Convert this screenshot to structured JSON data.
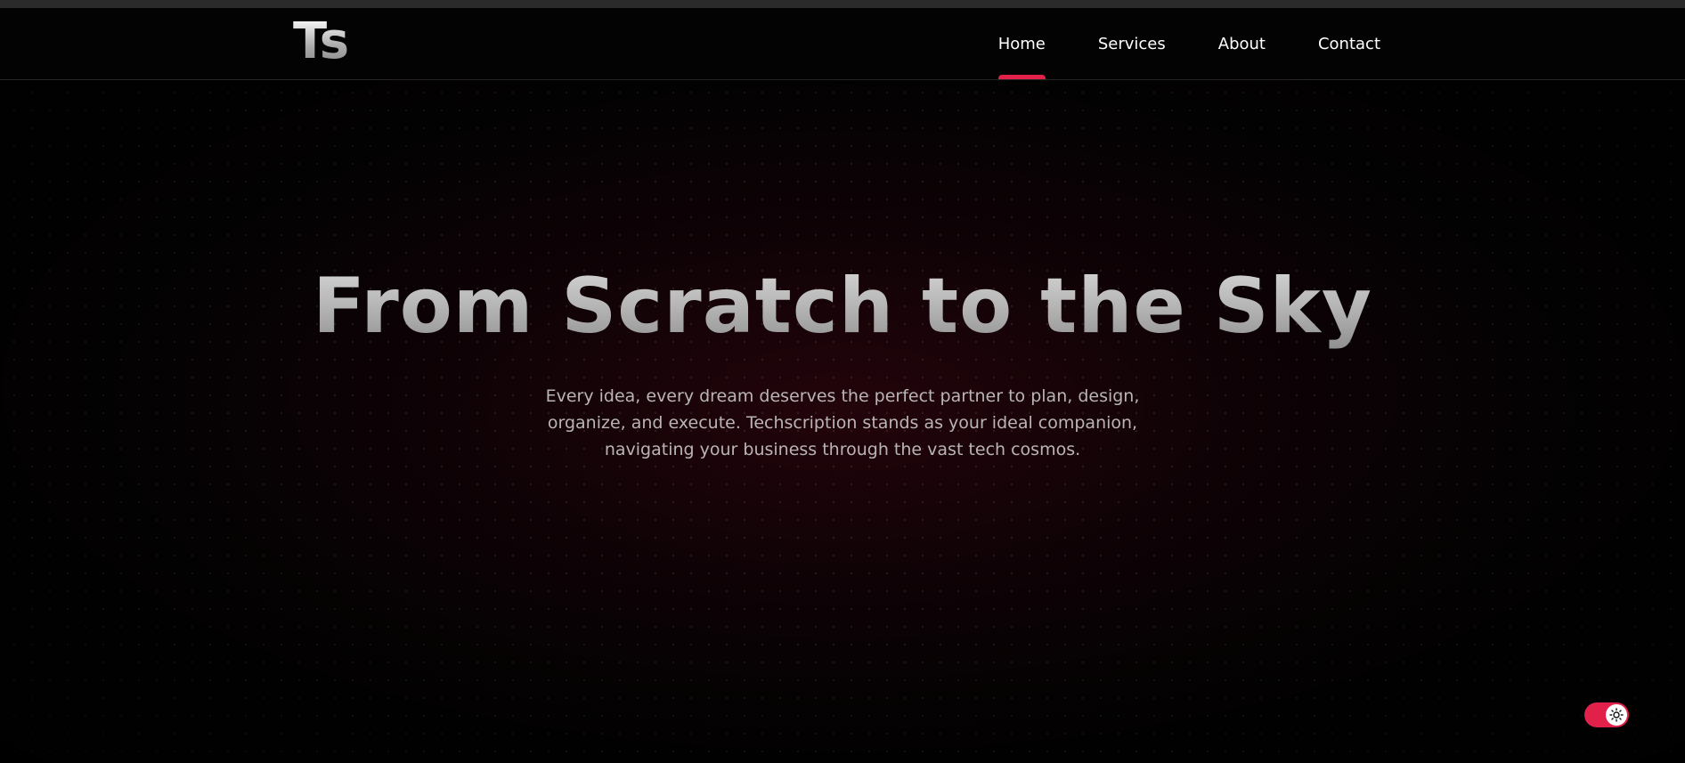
{
  "brand": {
    "logo_text": "Ts",
    "accent_color": "#e1214a"
  },
  "nav": {
    "items": [
      {
        "label": "Home",
        "active": true
      },
      {
        "label": "Services",
        "active": false
      },
      {
        "label": "About",
        "active": false
      },
      {
        "label": "Contact",
        "active": false
      }
    ]
  },
  "hero": {
    "headline": "From Scratch to the Sky",
    "subtext": "Every idea, every dream deserves the perfect partner to plan, design, organize, and execute. Techscription stands as your ideal companion, navigating your business through the vast tech cosmos."
  },
  "theme_toggle": {
    "icon": "sun-icon",
    "state": "on",
    "color": "#e1214a"
  }
}
